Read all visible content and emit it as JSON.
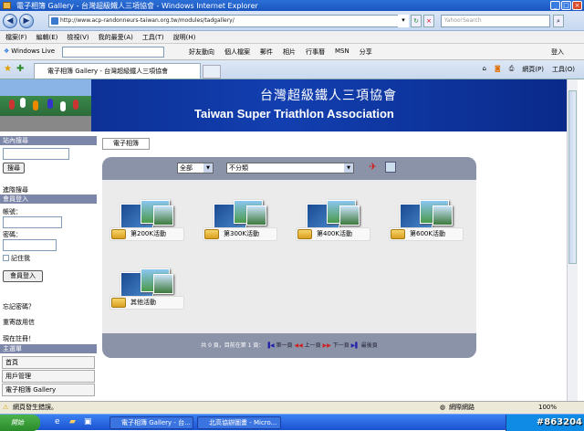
{
  "window": {
    "title": "電子相簿 Gallery - 台灣超級鐵人三項協會 - Windows Internet Explorer"
  },
  "address": {
    "url": "http://www.acp-randonneurs-taiwan.org.tw/modules/tadgallery/",
    "search_placeholder": "Yahoo!Search"
  },
  "menu": [
    "檔案(F)",
    "編輯(E)",
    "檢視(V)",
    "我的最愛(A)",
    "工具(T)",
    "說明(H)"
  ],
  "toolbar": {
    "live": "Windows Live",
    "links": [
      "好友動向",
      "個人檔案",
      "郵件",
      "相片",
      "行事曆",
      "MSN",
      "分享"
    ],
    "signin": "登入"
  },
  "tab": {
    "label": "電子相簿 Gallery - 台灣超級鐵人三項協會",
    "page_menu": "網頁(P)",
    "tools_menu": "工具(O)"
  },
  "banner": {
    "title_zh": "台灣超級鐵人三項協會",
    "title_en": "Taiwan Super Triathlon Association"
  },
  "sidebar": {
    "search_head": "站內搜尋",
    "search_btn": "搜尋",
    "adv_search": "進階搜尋",
    "login_head": "會員登入",
    "account_label": "帳號：",
    "password_label": "密碼：",
    "remember": "記住我",
    "login_btn": "會員登入",
    "forgot": "忘記密碼？",
    "resend": "重寄啟用信",
    "register": "現在註冊！",
    "menu_head": "主選單",
    "menu_items": [
      "首頁",
      "用戶管理",
      "電子相簿 Gallery"
    ]
  },
  "main": {
    "crumb": "電子相簿",
    "filter_all": "全部",
    "filter_cat": "不分類",
    "albums": [
      "第200K活動",
      "第300K活動",
      "第400K活動",
      "第600K活動",
      "其他活動"
    ],
    "pager": {
      "info": "共 0 頁，目前在第 1 頁：",
      "first": "第一頁",
      "prev": "上一頁",
      "next": "下一頁",
      "last": "最後頁"
    }
  },
  "status": {
    "text": "網頁發生錯誤。",
    "zone": "網際網路",
    "zoom": "100%"
  },
  "taskbar": {
    "start": "開始",
    "tasks": [
      "電子相簿 Gallery - 台...",
      "北高協辦圖畫 - Micro..."
    ],
    "watermark": "#863204"
  }
}
